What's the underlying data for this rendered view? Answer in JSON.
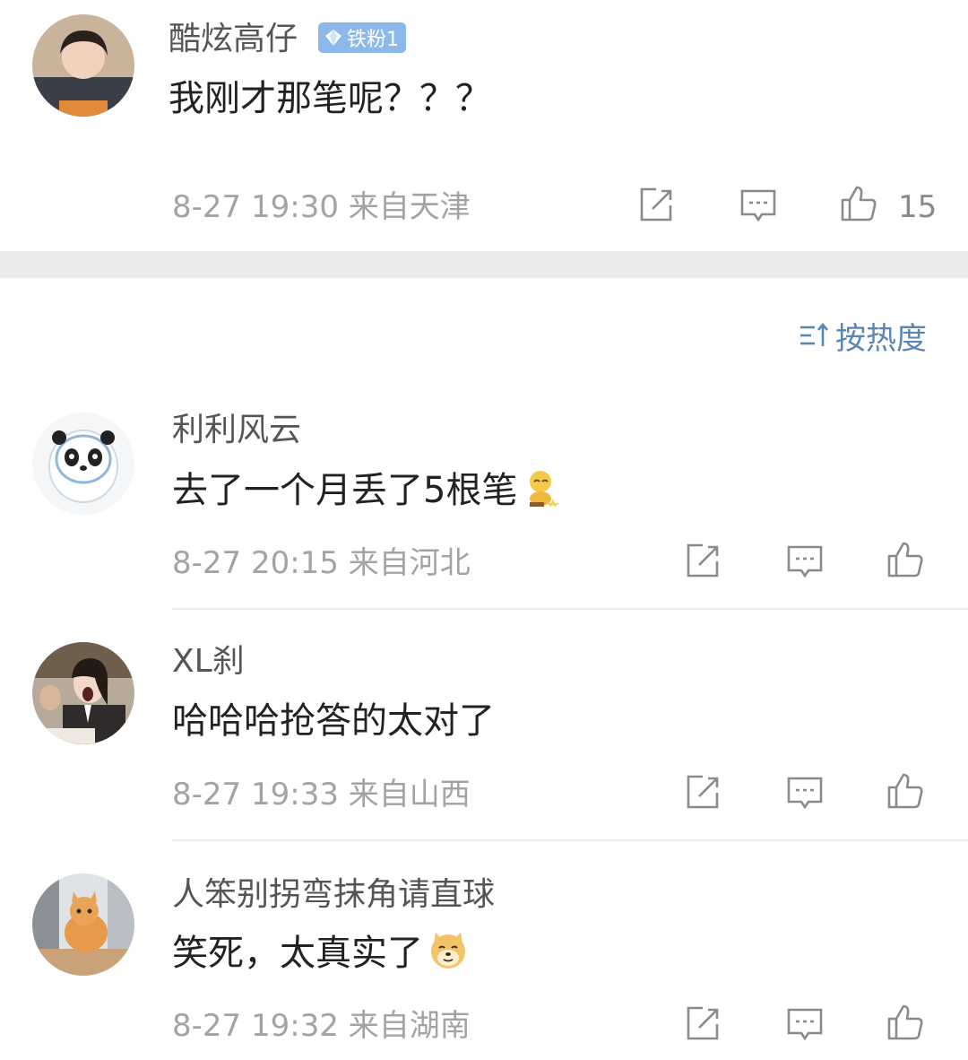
{
  "top_post": {
    "username": "酷炫高仔",
    "badge_label": "铁粉1",
    "content": "我刚才那笔呢？？？",
    "time": "8-27 19:30",
    "location": "来自天津",
    "like_count": "15"
  },
  "sort": {
    "label": "按热度",
    "icon": "sort-icon"
  },
  "comments": [
    {
      "username": "利利风云",
      "content": "去了一个月丢了5根笔",
      "emoji": "emoji-sitting-face",
      "time": "8-27 20:15",
      "location": "来自河北"
    },
    {
      "username": "XL刹",
      "content": "哈哈哈抢答的太对了",
      "time": "8-27 19:33",
      "location": "来自山西"
    },
    {
      "username": "人笨别拐弯抹角请直球",
      "content": "笑死，太真实了",
      "emoji": "emoji-doge",
      "time": "8-27 19:32",
      "location": "来自湖南"
    }
  ],
  "colors": {
    "accent_blue": "#5a86b3",
    "badge_blue": "#8db9ea",
    "meta_gray": "#a3a3a3",
    "band_gray": "#ececec"
  }
}
